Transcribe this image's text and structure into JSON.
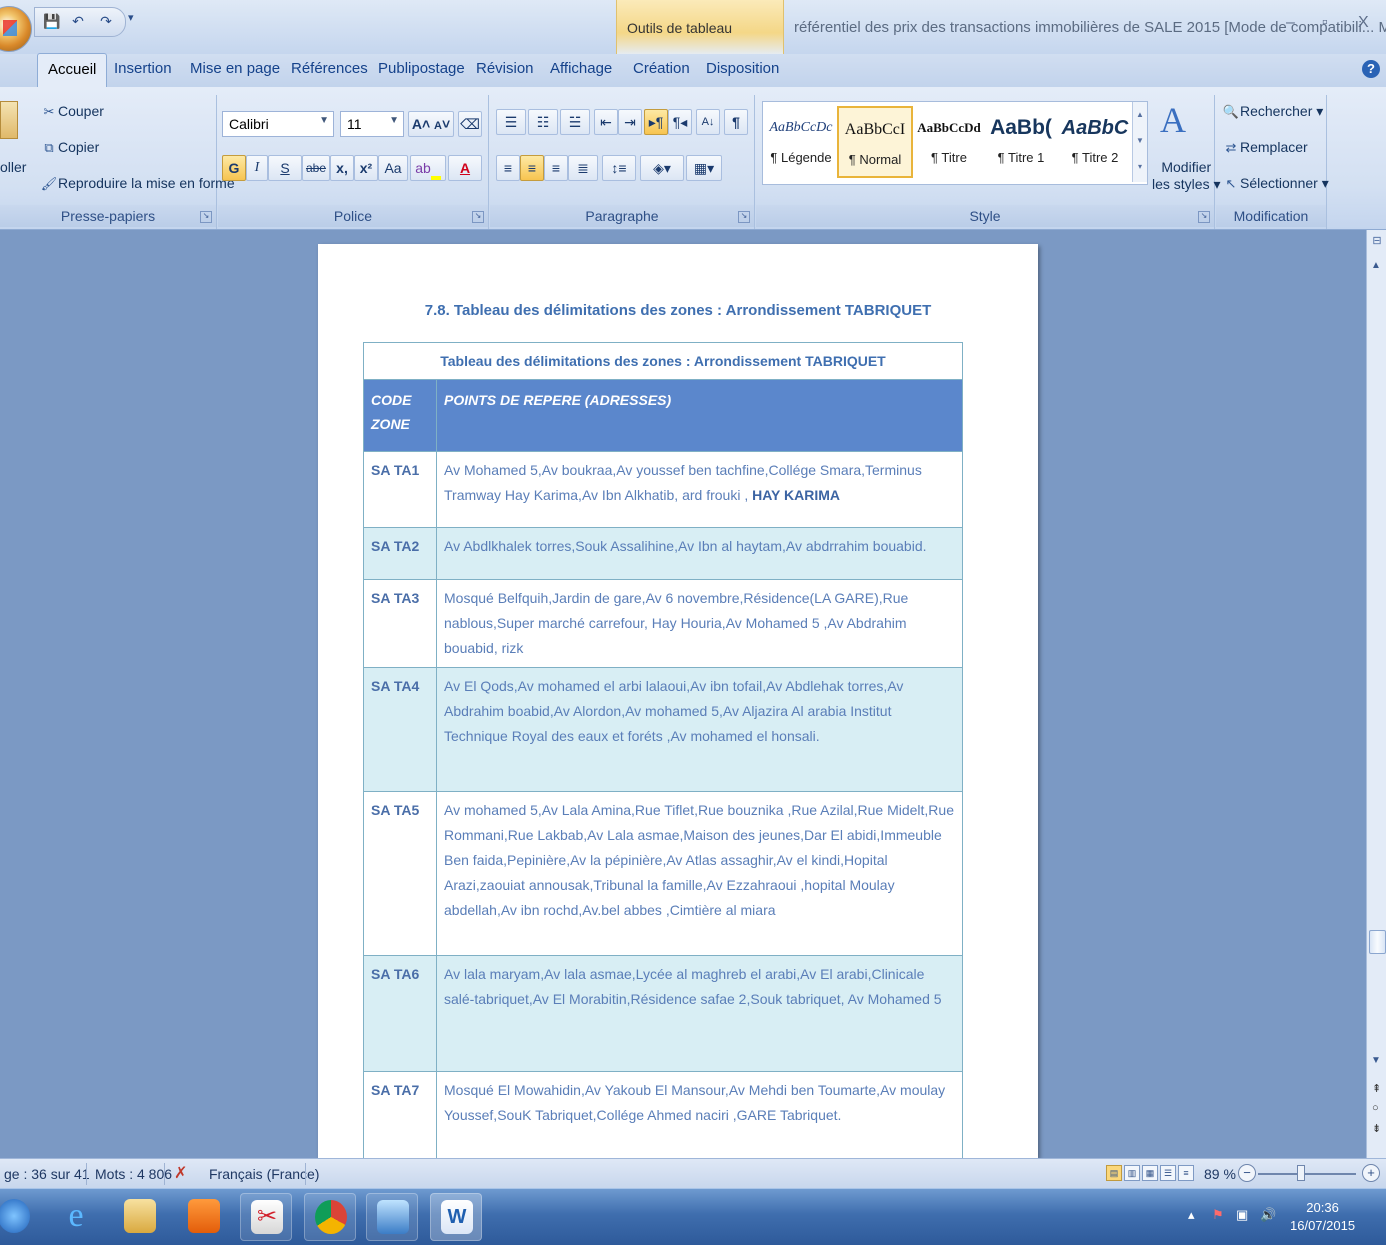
{
  "titlebar": {
    "context_tab": "Outils de tableau",
    "document_title": "référentiel des prix des transactions immobilières de SALE  2015 [Mode de compatibili...  M",
    "minimize": "–",
    "restore": "▫",
    "close": "X",
    "qat_more": "▾"
  },
  "tabs": [
    {
      "label": "Accueil"
    },
    {
      "label": "Insertion"
    },
    {
      "label": "Mise en page"
    },
    {
      "label": "Références"
    },
    {
      "label": "Publipostage"
    },
    {
      "label": "Révision"
    },
    {
      "label": "Affichage"
    },
    {
      "label": "Création"
    },
    {
      "label": "Disposition"
    }
  ],
  "ribbon": {
    "clipboard": {
      "paste": "oller",
      "cut": "Couper",
      "copy": "Copier",
      "format_painter": "Reproduire la mise en forme",
      "label": "Presse-papiers"
    },
    "font": {
      "name": "Calibri",
      "size": "11",
      "bold": "G",
      "italic": "I",
      "underline": "S",
      "strike": "abe",
      "subscript": "x,",
      "superscript": "x²",
      "change_case": "Aa",
      "grow": "A",
      "shrink": "A",
      "font_color": "A",
      "label": "Police"
    },
    "paragraph": {
      "show_marks": "¶",
      "label": "Paragraphe"
    },
    "styles": {
      "items": [
        {
          "sample": "AaBbCcDc",
          "name": "¶ Légende"
        },
        {
          "sample": "AaBbCcI",
          "name": "¶ Normal"
        },
        {
          "sample": "AaBbCcDd",
          "name": "¶ Titre"
        },
        {
          "sample": "AaBb(",
          "name": "¶ Titre 1"
        },
        {
          "sample": "AaBbC",
          "name": "¶ Titre 2"
        }
      ],
      "modify_line1": "Modifier",
      "modify_line2": "les styles",
      "label": "Style"
    },
    "editing": {
      "find": "Rechercher",
      "replace": "Remplacer",
      "select": "Sélectionner",
      "label": "Modification"
    }
  },
  "document": {
    "heading": "7.8. Tableau des délimitations des zones : Arrondissement TABRIQUET",
    "table": {
      "caption": "Tableau des délimitations des zones : Arrondissement TABRIQUET",
      "col_code": "CODE ZONE",
      "col_points": "POINTS DE REPERE  (ADRESSES)",
      "rows": [
        {
          "code": "SA TA1",
          "text": "Av Mohamed 5,Av boukraa,Av youssef ben tachfine,Collége Smara,Terminus Tramway Hay Karima,Av Ibn Alkhatib, ard frouki , ",
          "bold": "HAY KARIMA"
        },
        {
          "code": "SA TA2",
          "text": "Av Abdlkhalek torres,Souk Assalihine,Av Ibn al haytam,Av abdrrahim bouabid.",
          "bold": ""
        },
        {
          "code": "SA TA3",
          "text": "Mosqué Belfquih,Jardin de gare,Av 6 novembre,Résidence(LA GARE),Rue nablous,Super marché carrefour, Hay Houria,Av Mohamed 5 ,Av Abdrahim bouabid, rizk",
          "bold": ""
        },
        {
          "code": "SA TA4",
          "text": "Av El Qods,Av mohamed el arbi lalaoui,Av ibn tofail,Av Abdlehak torres,Av Abdrahim boabid,Av Alordon,Av mohamed 5,Av Aljazira Al arabia Institut Technique Royal des eaux et foréts ,Av mohamed el honsali.",
          "bold": ""
        },
        {
          "code": "SA TA5",
          "text": "Av mohamed 5,Av Lala Amina,Rue Tiflet,Rue bouznika ,Rue Azilal,Rue Midelt,Rue Rommani,Rue Lakbab,Av Lala asmae,Maison des jeunes,Dar El abidi,Immeuble Ben faida,Pepinière,Av la pépinière,Av Atlas assaghir,Av el kindi,Hopital Arazi,zaouiat annousak,Tribunal la famille,Av Ezzahraoui ,hopital Moulay abdellah,Av ibn rochd,Av.bel abbes ,Cimtière al miara",
          "bold": ""
        },
        {
          "code": "SA TA6",
          "text": "Av lala maryam,Av lala asmae,Lycée al maghreb el arabi,Av El arabi,Clinicale salé-tabriquet,Av El Morabitin,Résidence safae 2,Souk tabriquet, Av Mohamed 5",
          "bold": ""
        },
        {
          "code": "SA TA7",
          "text": "Mosqué El Mowahidin,Av Yakoub El Mansour,Av Mehdi ben Toumarte,Av moulay Youssef,SouK Tabriquet,Collége Ahmed naciri ,GARE Tabriquet.",
          "bold": ""
        }
      ]
    }
  },
  "statusbar": {
    "page": "ge : 36 sur 41",
    "words": "Mots : 4 806",
    "language": "Français (France)",
    "zoom": "89 %"
  },
  "taskbar": {
    "time": "20:36",
    "date": "16/07/2015"
  },
  "colors": {
    "header_fill": "#5b87cc",
    "alt_row_fill": "#d8eef4",
    "heading_text": "#3f6fb0"
  }
}
